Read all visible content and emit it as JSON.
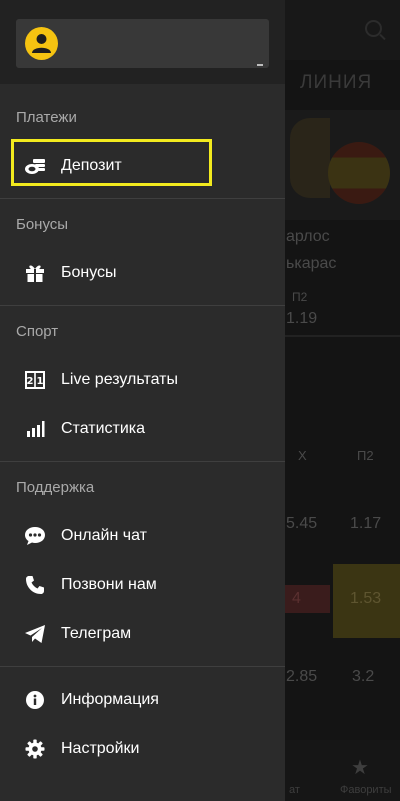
{
  "background": {
    "title": "ЛИНИЯ",
    "player_text_1": "арлос",
    "player_text_2": "ькарас",
    "odds_header_p2": "П2",
    "odds_value": "1.19",
    "col_x": "Х",
    "col_p2": "П2",
    "row1_x": "5.45",
    "row1_p2": "1.17",
    "row2_x": "4",
    "row2_p2": "1.53",
    "row3_x": "2.85",
    "row3_p2": "3.2",
    "tab_favorites": "Фавориты",
    "tab_partial": "ат"
  },
  "drawer": {
    "sections": [
      {
        "title": "Платежи",
        "items": [
          {
            "label": "Депозит",
            "icon": "cash-coins-icon"
          }
        ]
      },
      {
        "title": "Бонусы",
        "items": [
          {
            "label": "Бонусы",
            "icon": "gift-icon"
          }
        ]
      },
      {
        "title": "Спорт",
        "items": [
          {
            "label": "Live результаты",
            "icon": "scoreboard-icon"
          },
          {
            "label": "Статистика",
            "icon": "bar-chart-icon"
          }
        ]
      },
      {
        "title": "Поддержка",
        "items": [
          {
            "label": "Онлайн чат",
            "icon": "chat-bubble-icon"
          },
          {
            "label": "Позвони нам",
            "icon": "phone-icon"
          },
          {
            "label": "Телеграм",
            "icon": "telegram-icon"
          }
        ]
      },
      {
        "title": "",
        "items": [
          {
            "label": "Информация",
            "icon": "info-icon"
          },
          {
            "label": "Настройки",
            "icon": "gear-icon"
          }
        ]
      }
    ]
  },
  "colors": {
    "drawer_bg": "#2b2b2b",
    "header_bg": "#222222",
    "avatar": "#f5c311",
    "highlight": "#f2ea1e"
  }
}
